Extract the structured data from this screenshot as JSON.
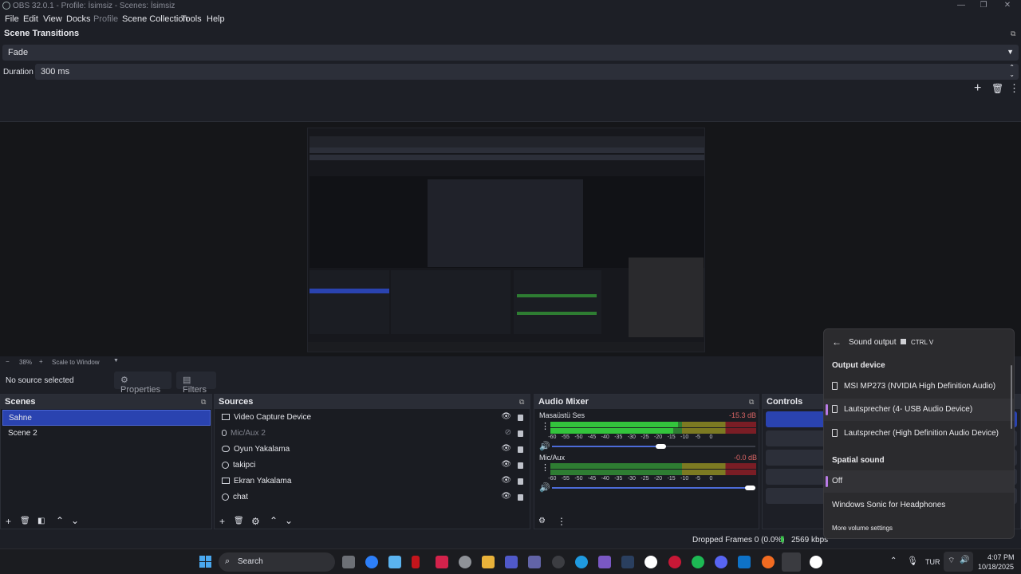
{
  "window": {
    "title": "OBS 32.0.1 - Profile: İsimsiz - Scenes: İsimsiz"
  },
  "menu": [
    "File",
    "Edit",
    "View",
    "Docks",
    "Profile",
    "Scene Collection",
    "Tools",
    "Help"
  ],
  "transitions": {
    "title": "Scene Transitions",
    "transition_value": "Fade",
    "duration_label": "Duration",
    "duration_value": "300 ms"
  },
  "zoom": {
    "minus": "−",
    "value": "38%",
    "plus": "+",
    "mode": "Scale to Window"
  },
  "context": {
    "no_source": "No source selected",
    "properties": "Properties",
    "filters": "Filters"
  },
  "scenes": {
    "title": "Scenes",
    "items": [
      "Sahne",
      "Scene 2"
    ],
    "selected": "Sahne"
  },
  "sources": {
    "title": "Sources",
    "items": [
      {
        "name": "Video Capture Device",
        "icon": "camera-icon",
        "visible": true
      },
      {
        "name": "Mic/Aux 2",
        "icon": "mic-icon",
        "visible": false
      },
      {
        "name": "Oyun Yakalama",
        "icon": "gamepad-icon",
        "visible": true
      },
      {
        "name": "takipci",
        "icon": "globe-icon",
        "visible": true
      },
      {
        "name": "Ekran Yakalama",
        "icon": "monitor-icon",
        "visible": true
      },
      {
        "name": "chat",
        "icon": "globe-icon",
        "visible": true
      }
    ]
  },
  "mixer": {
    "title": "Audio Mixer",
    "ticks": [
      "-60",
      "-55",
      "-50",
      "-45",
      "-40",
      "-35",
      "-30",
      "-25",
      "-20",
      "-15",
      "-10",
      "-5",
      "0"
    ],
    "channels": [
      {
        "name": "Masaüstü Ses",
        "db": "-15.3 dB",
        "level": 0.62,
        "volume": 0.56
      },
      {
        "name": "Mic/Aux",
        "db": "-0.0 dB",
        "level": 0.0,
        "volume": 1.0
      }
    ]
  },
  "controls": {
    "title": "Controls"
  },
  "status": {
    "dropped": "Dropped Frames 0 (0.0%)",
    "bitrate": "2569 kbps"
  },
  "flyout": {
    "title": "Sound output",
    "shortcut": "CTRL  V",
    "output_header": "Output device",
    "devices": [
      "MSI MP273 (NVIDIA High Definition Audio)",
      "Lautsprecher (4- USB Audio Device)",
      "Lautsprecher (High Definition Audio Device)"
    ],
    "selected_device": "Lautsprecher (4- USB Audio Device)",
    "spatial_header": "Spatial sound",
    "spatial_options": [
      "Off",
      "Windows Sonic for Headphones"
    ],
    "more": "More volume settings"
  },
  "taskbar": {
    "search": "Search",
    "lang": "TUR",
    "time": "4:07 PM",
    "date": "10/18/2025"
  }
}
